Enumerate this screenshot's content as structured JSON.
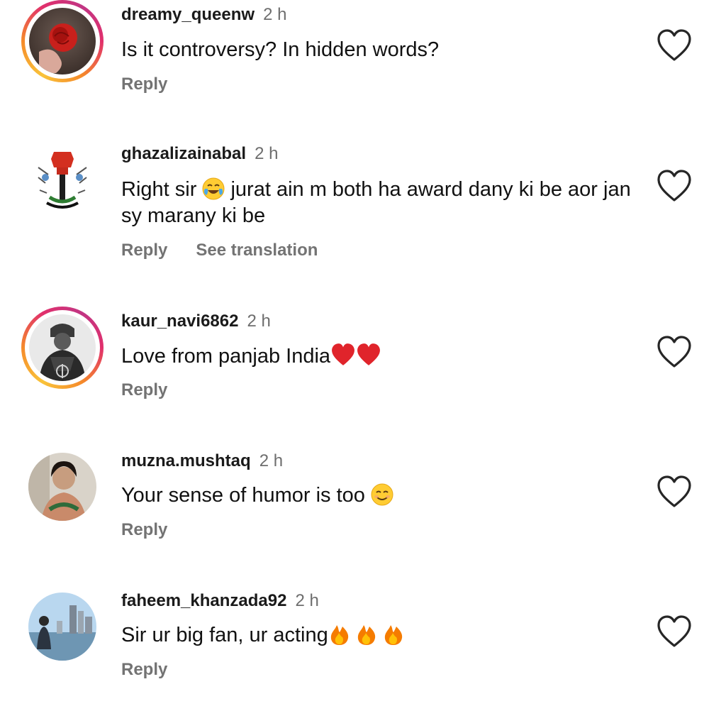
{
  "comments": [
    {
      "username": "dreamy_queenw",
      "time": "2 h",
      "text": "Is it controversy? In hidden words?",
      "reply": "Reply",
      "avatar_icon": "red-rose-avatar"
    },
    {
      "username": "ghazalizainabal",
      "time": "2 h",
      "text_parts": [
        "Right sir ",
        " jurat ain m both ha award dany ki be aor jan sy marany ki be"
      ],
      "emoji": "face-with-tears-of-joy",
      "reply": "Reply",
      "translate": "See translation",
      "avatar_icon": "fist-flag-avatar"
    },
    {
      "username": "kaur_navi6862",
      "time": "2 h",
      "text": "Love from panjab India",
      "emoji": "red-heart",
      "emoji_count": 2,
      "reply": "Reply",
      "avatar_icon": "warrior-avatar"
    },
    {
      "username": "muzna.mushtaq",
      "time": "2 h",
      "text": "Your sense of humor is too ",
      "emoji": "smiling-face",
      "reply": "Reply",
      "avatar_icon": "person-photo-avatar"
    },
    {
      "username": "faheem_khanzada92",
      "time": "2 h",
      "text": "Sir ur big fan, ur acting",
      "emoji": "fire",
      "emoji_count": 3,
      "reply": "Reply",
      "avatar_icon": "city-photo-avatar"
    }
  ],
  "colors": {
    "username": "#1a1a1a",
    "secondary": "#737373",
    "heart_outline": "#262626",
    "story_ring": [
      "#f9c33a",
      "#e1306c",
      "#c13584"
    ]
  }
}
